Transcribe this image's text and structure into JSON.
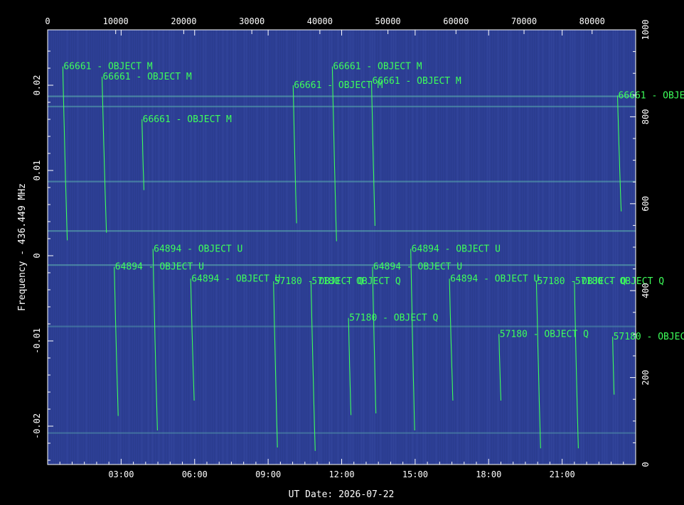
{
  "chart_data": {
    "type": "scatter",
    "title": "",
    "xlabel": "UT Date: 2026-07-22",
    "ylabel": "Frequency - 436.449 MHz",
    "xlim_hours": [
      0,
      24
    ],
    "ylim": [
      -0.0245,
      0.0265
    ],
    "top_axis_lim": [
      0,
      86400
    ],
    "right_axis_lim": [
      0,
      1000
    ],
    "x_ticks": [
      "03:00",
      "06:00",
      "09:00",
      "12:00",
      "15:00",
      "18:00",
      "21:00"
    ],
    "x_tick_hours": [
      3,
      6,
      9,
      12,
      15,
      18,
      21
    ],
    "y_ticks": [
      0.02,
      0.01,
      0,
      -0.01,
      -0.02
    ],
    "y_tick_labels": [
      "0.02",
      "0.01",
      "0",
      "-0.01",
      "-0.02"
    ],
    "top_ticks": [
      0,
      10000,
      20000,
      30000,
      40000,
      50000,
      60000,
      70000,
      80000
    ],
    "right_ticks": [
      0,
      200,
      400,
      600,
      800,
      1000
    ],
    "background": "#2d3f95",
    "trail_color": "#3dff5a",
    "grid": false,
    "horizontal_bands": [
      {
        "y": 0.0187,
        "color": "#5fb8b0"
      },
      {
        "y": 0.0175,
        "color": "#58a8ae"
      },
      {
        "y": 0.0087,
        "color": "#5aaeb0"
      },
      {
        "y": 0.0029,
        "color": "#60bcb2"
      },
      {
        "y": -0.0011,
        "color": "#60bcb2"
      },
      {
        "y": -0.0083,
        "color": "#4e8fa8"
      },
      {
        "y": -0.0208,
        "color": "#4e8fa8"
      }
    ],
    "series": [
      {
        "name": "66661 - OBJECT M",
        "passes": [
          {
            "t_start": 0.62,
            "t_end": 0.8,
            "f_start": 0.0222,
            "f_end": 0.0018
          },
          {
            "t_start": 2.22,
            "t_end": 2.4,
            "f_start": 0.021,
            "f_end": 0.0027
          },
          {
            "t_start": 3.85,
            "t_end": 3.93,
            "f_start": 0.016,
            "f_end": 0.0077
          },
          {
            "t_start": 10.02,
            "t_end": 10.16,
            "f_start": 0.02,
            "f_end": 0.0038
          },
          {
            "t_start": 11.62,
            "t_end": 11.79,
            "f_start": 0.0222,
            "f_end": 0.0017
          },
          {
            "t_start": 13.22,
            "t_end": 13.36,
            "f_start": 0.0205,
            "f_end": 0.0035
          },
          {
            "t_start": 23.26,
            "t_end": 23.41,
            "f_start": 0.0188,
            "f_end": 0.0052
          }
        ]
      },
      {
        "name": "64894 - OBJECT U",
        "passes": [
          {
            "t_start": 2.72,
            "t_end": 2.88,
            "f_start": -0.0013,
            "f_end": -0.0188
          },
          {
            "t_start": 4.3,
            "t_end": 4.48,
            "f_start": 0.0008,
            "f_end": -0.0205
          },
          {
            "t_start": 5.84,
            "t_end": 5.98,
            "f_start": -0.0027,
            "f_end": -0.017
          },
          {
            "t_start": 13.26,
            "t_end": 13.4,
            "f_start": -0.0013,
            "f_end": -0.0185
          },
          {
            "t_start": 14.82,
            "t_end": 14.98,
            "f_start": 0.0008,
            "f_end": -0.0205
          },
          {
            "t_start": 16.4,
            "t_end": 16.54,
            "f_start": -0.0027,
            "f_end": -0.017
          }
        ]
      },
      {
        "name": "57180 - OBJECT Q",
        "passes": [
          {
            "t_start": 9.22,
            "t_end": 9.38,
            "f_start": -0.003,
            "f_end": -0.0225
          },
          {
            "t_start": 10.75,
            "t_end": 10.92,
            "f_start": -0.003,
            "f_end": -0.0229
          },
          {
            "t_start": 12.28,
            "t_end": 12.38,
            "f_start": -0.0073,
            "f_end": -0.0187
          },
          {
            "t_start": 18.42,
            "t_end": 18.5,
            "f_start": -0.0092,
            "f_end": -0.017
          },
          {
            "t_start": 19.95,
            "t_end": 20.12,
            "f_start": -0.003,
            "f_end": -0.0226
          },
          {
            "t_start": 21.5,
            "t_end": 21.66,
            "f_start": -0.003,
            "f_end": -0.0226
          },
          {
            "t_start": 23.06,
            "t_end": 23.12,
            "f_start": -0.0095,
            "f_end": -0.0163
          }
        ]
      }
    ]
  }
}
